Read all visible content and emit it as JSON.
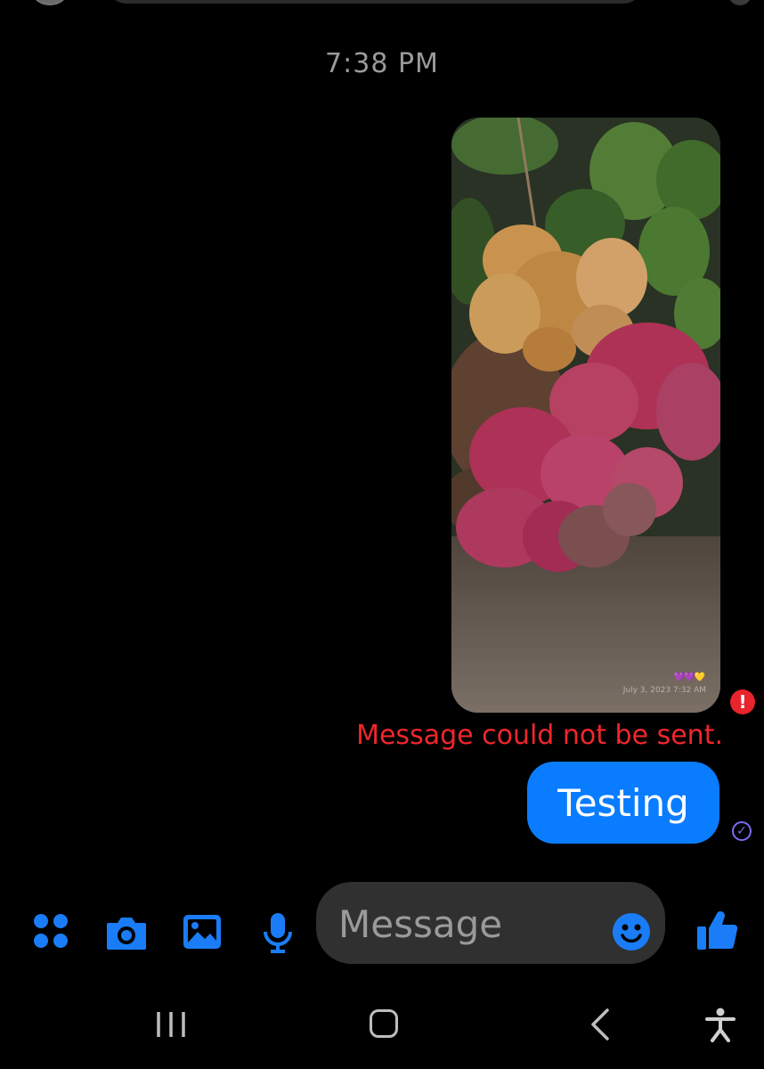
{
  "conversation": {
    "timestamp": "7:38 PM",
    "image_message": {
      "caption_hearts": "💜💜💛",
      "caption_date": "July 3, 2023 7:32 AM",
      "error_text": "Message could not be sent."
    },
    "text_message": {
      "text": "Testing",
      "status": "sent"
    }
  },
  "composer": {
    "placeholder": "Message",
    "icons": [
      "menu-dots-icon",
      "camera-icon",
      "gallery-icon",
      "microphone-icon",
      "emoji-icon",
      "like-icon"
    ]
  },
  "system_nav": {
    "icons": [
      "recents-icon",
      "home-icon",
      "back-icon",
      "accessibility-icon"
    ]
  },
  "colors": {
    "accent": "#0a7cff",
    "error": "#f0262c",
    "background": "#000000",
    "composer_bg": "#303030"
  }
}
